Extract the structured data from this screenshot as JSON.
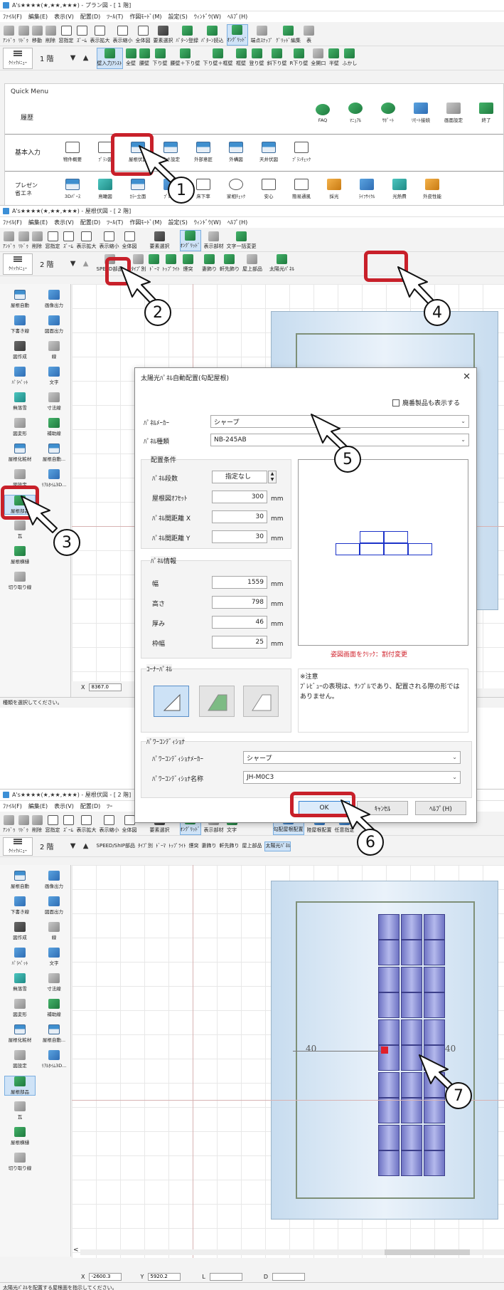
{
  "window1": {
    "title": "A's★★★★(★,★★,★★★) - プラン図 - [ 1 階]",
    "menu": [
      "ﾌｧｲﾙ(F)",
      "編集(E)",
      "表示(V)",
      "配置(D)",
      "ﾂｰﾙ(T)",
      "作図ﾓｰﾄﾞ(M)",
      "設定(S)",
      "ｳｨﾝﾄﾞｳ(W)",
      "ﾍﾙﾌﾟ(H)"
    ],
    "toolbar": [
      "ｱﾝﾄﾞｩ",
      "ﾘﾄﾞｩ",
      "移動",
      "削除",
      "窓指定",
      "ｽﾞｰﾑ",
      "表示拡大",
      "表示縮小",
      "全体図",
      "要素選択",
      "ﾊﾟﾀｰﾝ登録",
      "ﾊﾟﾀｰﾝ読込",
      "ｵﾝｸﾞﾘｯﾄﾞ",
      "端点ｽﾅｯﾌﾟ",
      "ｸﾞﾘｯﾄﾞ編集",
      "表"
    ],
    "floor": "1 階",
    "row2": [
      "壁入力ｱｼｽﾄ",
      "全壁",
      "腰壁",
      "下り壁",
      "腰壁＋下り壁",
      "下り壁＋框壁",
      "框壁",
      "登り壁",
      "斜下り壁",
      "R下り壁",
      "全開口",
      "半壁",
      "ふかし"
    ],
    "quick_menu_label": "ｸｲｯｸﾒﾆｭｰ",
    "quick_menu": {
      "title": "Quick Menu",
      "history_label": "履歴",
      "support": [
        "FAQ",
        "ﾏﾆｭｱﾙ",
        "ｻﾎﾟｰﾄ",
        "ﾘﾓｰﾄ接続",
        "画面設定",
        "終了"
      ],
      "basic_label": "基本入力",
      "basic": [
        "物件概要",
        "ﾌﾟﾗﾝ図",
        "屋根伏図",
        "高さ設定",
        "外部意匠",
        "外構図",
        "天井伏図",
        "ﾌﾟﾗﾝﾁｪｯｸ"
      ],
      "present_label": "プレゼン\n省エネ",
      "present": [
        "3Dﾊﾟｰｽ",
        "鳥瞰図",
        "ｶﾗｰ立面",
        "ﾌﾟﾚｾﾞﾝ",
        "床下率",
        "家相ﾁｪｯｸ",
        "安心",
        "簡易通風",
        "採光",
        "ﾗｲﾌｻｲｸﾙ",
        "光熱費",
        "外皮性能"
      ]
    }
  },
  "window2": {
    "title": "A's★★★★(★,★★,★★★) - 屋根伏図 - [ 2 階]",
    "menu": [
      "ﾌｧｲﾙ(F)",
      "編集(E)",
      "表示(V)",
      "配置(D)",
      "ﾂｰﾙ(T)",
      "作図ﾓｰﾄﾞ(M)",
      "設定(S)",
      "ｳｨﾝﾄﾞｳ(W)",
      "ﾍﾙﾌﾟ(H)"
    ],
    "toolbar": [
      "ｱﾝﾄﾞｩ",
      "ﾘﾄﾞｩ",
      "削除",
      "窓指定",
      "ｽﾞｰﾑ",
      "表示拡大",
      "表示縮小",
      "全体図",
      "要素選択",
      "ｵﾝｸﾞﾘｯﾄﾞ",
      "表示部材",
      "文字一括変更"
    ],
    "floor": "2 階",
    "row2": [
      "SPEED部品",
      "ﾀｲﾌﾟ別",
      "ﾄﾞｰﾏ",
      "ﾄｯﾌﾟﾗｲﾄ",
      "煙突",
      "妻飾り",
      "軒先飾り",
      "屋上部品",
      "太陽光ﾊﾟﾈﾙ"
    ],
    "left": [
      "屋根自動",
      "画像出力",
      "下書き線",
      "図面出力",
      "図作成",
      "線",
      "ﾊﾟﾗﾍﾟｯﾄ",
      "文字",
      "無落雪",
      "寸法線",
      "図変形",
      "補助線",
      "屋根化粧材",
      "屋根自動...",
      "図設定",
      "ﾘｱﾙﾀｲﾑ3D...",
      "屋根部品",
      "瓦",
      "屋根横樋",
      "切り取り線"
    ],
    "coord_x_label": "X",
    "coord_x_value": "8367.0",
    "status": "種類を選択してください。"
  },
  "dialog": {
    "title": "太陽光ﾊﾟﾈﾙ自動配置(勾配屋根)",
    "discontinued_label": "廃番製品も表示する",
    "maker_label": "ﾊﾟﾈﾙﾒｰｶｰ",
    "maker_value": "シャープ",
    "type_label": "ﾊﾟﾈﾙ種類",
    "type_value": "NB-245AB",
    "layout_group": "配置条件",
    "rows_label": "ﾊﾟﾈﾙ段数",
    "rows_value": "指定なし",
    "offset_label": "屋根図ｵﾌｾｯﾄ",
    "offset_value": "300",
    "gap_x_label": "ﾊﾟﾈﾙ間距離 X",
    "gap_x_value": "30",
    "gap_y_label": "ﾊﾟﾈﾙ間距離 Y",
    "gap_y_value": "30",
    "info_group": "ﾊﾟﾈﾙ情報",
    "width_label": "幅",
    "width_value": "1559",
    "height_label": "高さ",
    "height_value": "798",
    "thickness_label": "厚み",
    "thickness_value": "46",
    "frame_label": "枠幅",
    "frame_value": "25",
    "unit": "mm",
    "preview_hint": "姿図画面をｸﾘｯｸ：割付変更",
    "corner_group": "ｺｰﾅｰﾊﾟﾈﾙ",
    "note_title": "※注意",
    "note_text": "ﾌﾟﾚﾋﾞｭｰの表現は、ｻﾝﾌﾟﾙであり、配置される際の形ではありません。",
    "pc_group": "ﾊﾟﾜｰｺﾝﾃﾞｨｼｮﾅ",
    "pc_maker_label": "ﾊﾟﾜｰｺﾝﾃﾞｨｼｮﾅﾒｰｶｰ",
    "pc_maker_value": "シャープ",
    "pc_name_label": "ﾊﾟﾜｰｺﾝﾃﾞｨｼｮﾅ名称",
    "pc_name_value": "JH-M0C3",
    "ok": "OK",
    "cancel": "ｷｬﾝｾﾙ",
    "help": "ﾍﾙﾌﾟ(H)"
  },
  "window3": {
    "title": "A's★★★★(★,★★,★★★) - 屋根伏図 - [ 2 階]",
    "menu": [
      "ﾌｧｲﾙ(F)",
      "編集(E)",
      "表示(V)",
      "配置(D)",
      "ﾂｰ"
    ],
    "toolbar_right": [
      "勾配屋根配置",
      "陸屋根配置",
      "任意指定"
    ],
    "toolbar": [
      "ｱﾝﾄﾞｩ",
      "ﾘﾄﾞｩ",
      "削除",
      "窓指定",
      "ｽﾞｰﾑ",
      "表示拡大",
      "表示縮小",
      "全体図",
      "要素選択",
      "ｵﾝｸﾞﾘｯﾄﾞ",
      "表示部材",
      "文字"
    ],
    "floor": "2 階",
    "row2": [
      "SPEED/ShIP部品",
      "ﾀｲﾌﾟ別",
      "ﾄﾞｰﾏ",
      "ﾄｯﾌﾟﾗｲﾄ",
      "煙突",
      "妻飾り",
      "軒先飾り",
      "屋上部品",
      "太陽光ﾊﾟﾈﾙ"
    ],
    "dim_left": "40",
    "dim_right": "40",
    "coord_x_label": "X",
    "coord_x_value": "-2600.3",
    "coord_y_label": "Y",
    "coord_y_value": "5920.2",
    "coord_l_label": "L",
    "coord_d_label": "D",
    "status": "太陽光ﾊﾟﾈﾙを配置する屋根面を指示してください。"
  },
  "callouts": [
    "1",
    "2",
    "3",
    "4",
    "5",
    "6",
    "7"
  ],
  "colors": {
    "highlight": "#c8202a",
    "panel": "#6f74c4",
    "preview_line": "#1c33c8",
    "hint_red": "#d0202a",
    "roof": "#c7dcef"
  }
}
